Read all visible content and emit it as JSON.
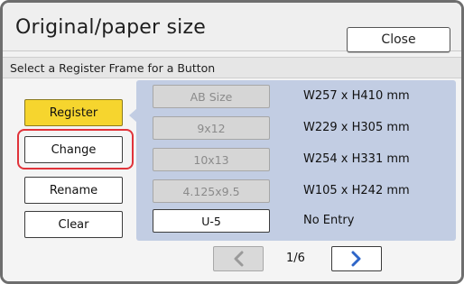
{
  "header": {
    "title": "Original/paper size",
    "close_label": "Close"
  },
  "subheader": {
    "text": "Select a Register Frame for a Button"
  },
  "actions": {
    "register": "Register",
    "change": "Change",
    "rename": "Rename",
    "clear": "Clear"
  },
  "sizes": [
    {
      "button": "AB Size",
      "dimension": "W257 x H410 mm",
      "enabled": false
    },
    {
      "button": "9x12",
      "dimension": "W229 x H305 mm",
      "enabled": false
    },
    {
      "button": "10x13",
      "dimension": "W254 x H331 mm",
      "enabled": false
    },
    {
      "button": "4.125x9.5",
      "dimension": "W105 x H242 mm",
      "enabled": false
    },
    {
      "button": "U-5",
      "dimension": "No Entry",
      "enabled": true
    }
  ],
  "pager": {
    "indicator": "1/6"
  },
  "colors": {
    "active_button": "#f6d52e",
    "highlight": "#e0333a",
    "panel": "#c2cde3",
    "arrow_next": "#2f66c8",
    "arrow_prev": "#9a9a9a"
  },
  "icons": {
    "prev": "chevron-left-icon",
    "next": "chevron-right-icon"
  }
}
